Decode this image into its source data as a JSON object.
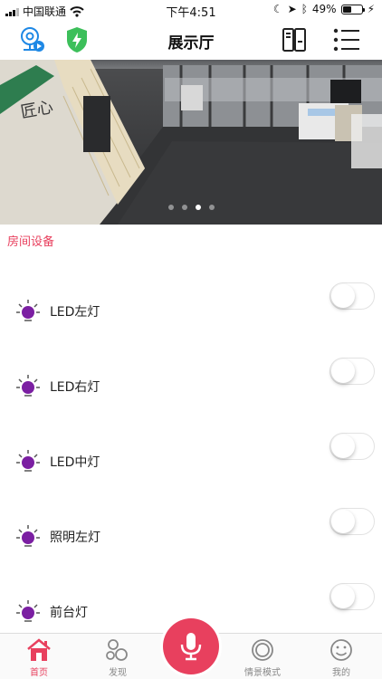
{
  "status_bar": {
    "carrier": "中国联通",
    "time": "下午4:51",
    "battery": "49%",
    "battery_level": 0.49
  },
  "header": {
    "title": "展示厅",
    "left_icons": [
      "camera-icon",
      "shield-bolt-icon"
    ],
    "right_icons": [
      "panel-icon",
      "menu-icon"
    ]
  },
  "banner": {
    "image": "camera-view-showroom",
    "dots": 4,
    "active_dot": 3
  },
  "section": {
    "title": "房间设备"
  },
  "devices": [
    {
      "label": "LED左灯",
      "on": false
    },
    {
      "label": "LED右灯",
      "on": false
    },
    {
      "label": "LED中灯",
      "on": false
    },
    {
      "label": "照明左灯",
      "on": false
    },
    {
      "label": "前台灯",
      "on": false
    }
  ],
  "tabbar": {
    "tabs": [
      {
        "label": "首页",
        "icon": "home-icon",
        "active": true
      },
      {
        "label": "发现",
        "icon": "discover-icon",
        "active": false
      },
      {
        "label": "情景模式",
        "icon": "scene-icon",
        "active": false
      },
      {
        "label": "我的",
        "icon": "profile-icon",
        "active": false
      }
    ],
    "center_icon": "microphone-icon"
  },
  "colors": {
    "accent": "#e8405e",
    "bulb": "#7b1fa2",
    "header_green": "#3cbf5a",
    "header_blue": "#1e88e5"
  }
}
